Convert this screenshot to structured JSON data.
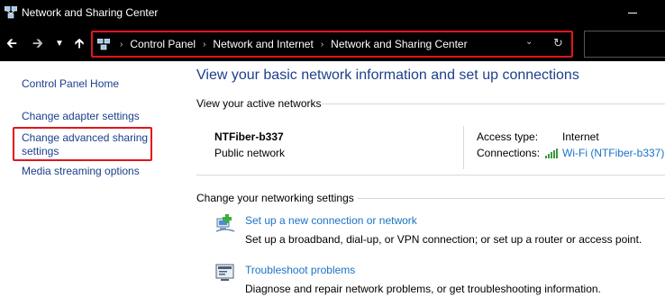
{
  "window": {
    "title": "Network and Sharing Center"
  },
  "address_bar": {
    "breadcrumbs": [
      "Control Panel",
      "Network and Internet",
      "Network and Sharing Center"
    ],
    "separator": "›"
  },
  "left_pane": {
    "links": [
      "Control Panel Home",
      "Change adapter settings",
      "Change advanced sharing settings",
      "Media streaming options"
    ]
  },
  "main": {
    "title": "View your basic network information and set up connections",
    "active_networks_label": "View your active networks",
    "network": {
      "name": "NTFiber-b337",
      "type": "Public network",
      "access_type_label": "Access type:",
      "access_type_value": "Internet",
      "connections_label": "Connections:",
      "connections_value": "Wi-Fi (NTFiber-b337)"
    },
    "change_settings_label": "Change your networking settings",
    "tasks": [
      {
        "icon": "new-connection-icon",
        "link": "Set up a new connection or network",
        "description": "Set up a broadband, dial-up, or VPN connection; or set up a router or access point."
      },
      {
        "icon": "troubleshoot-icon",
        "link": "Troubleshoot problems",
        "description": "Diagnose and repair network problems, or get troubleshooting information."
      }
    ]
  },
  "colors": {
    "highlight": "#e0161d",
    "title_blue": "#1e3f8a",
    "link_blue": "#1a73c6",
    "nav_link": "#1a3e8c",
    "titlebar_bg": "#000000"
  }
}
